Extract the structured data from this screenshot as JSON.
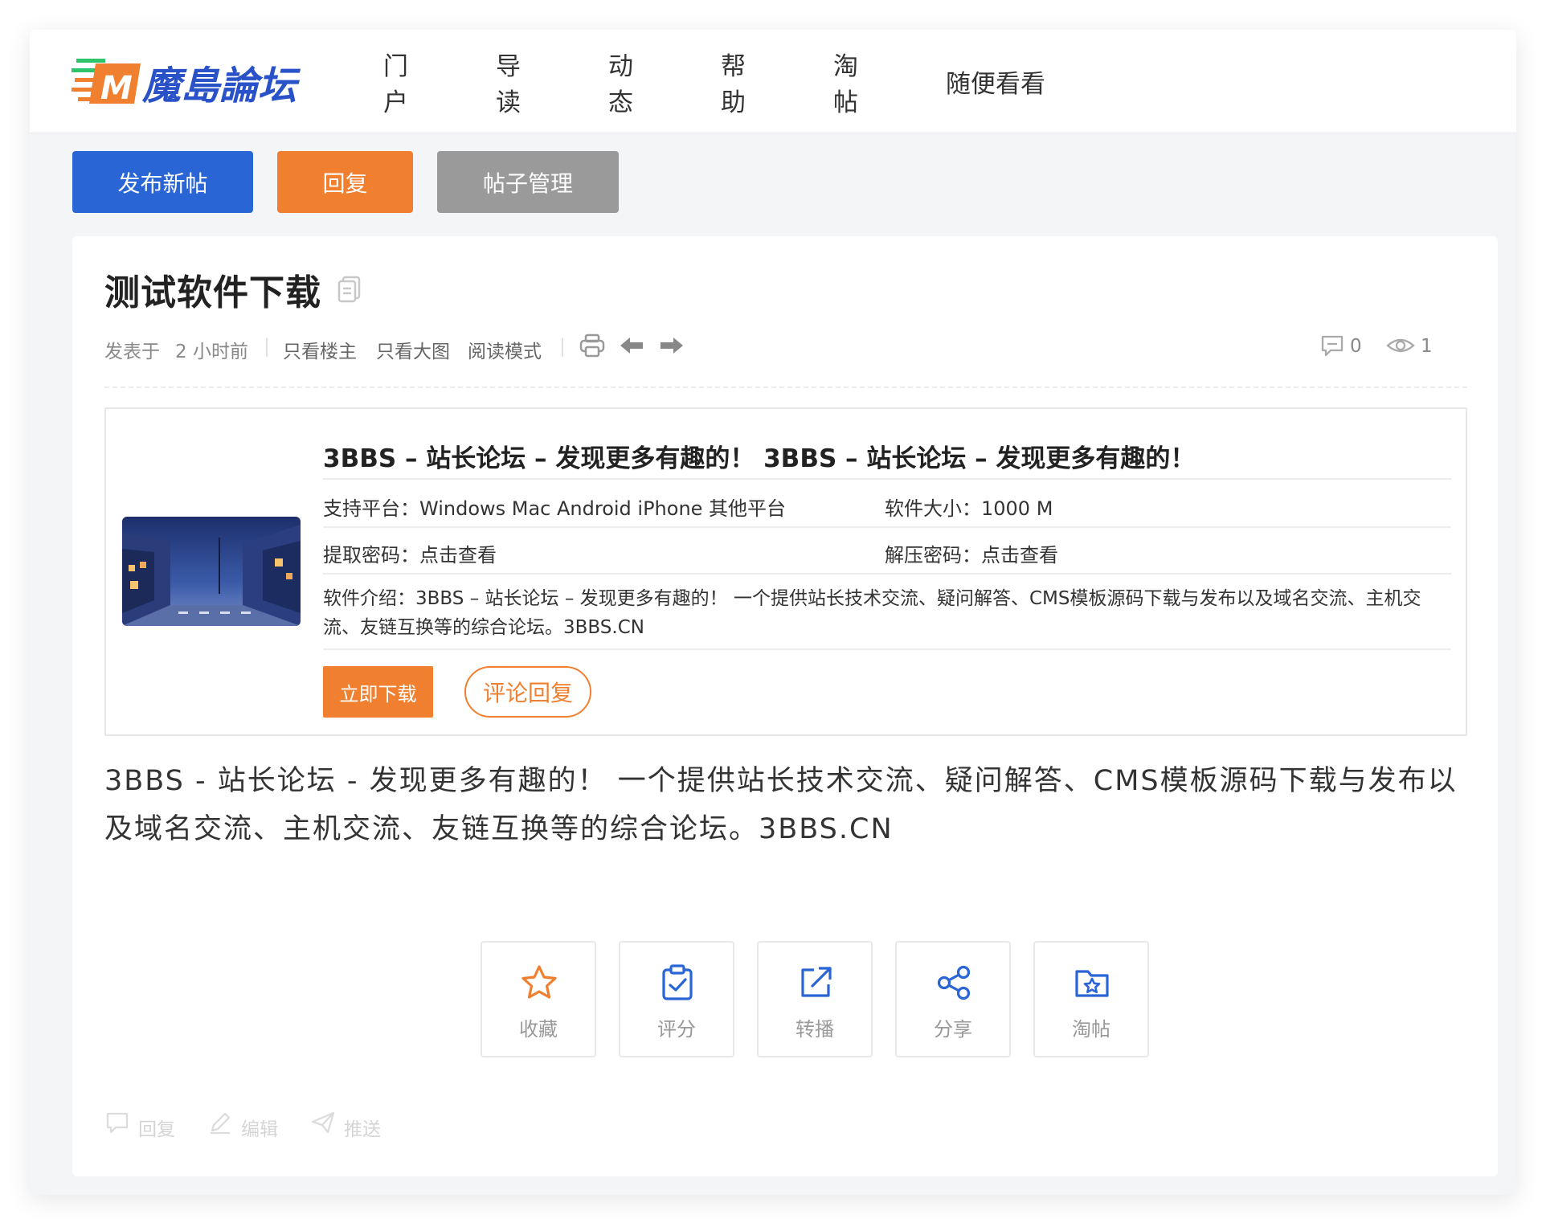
{
  "brand": {
    "logo_text": "魔島論坛",
    "logo_mark": "M",
    "colors": {
      "blue": "#2a65d6",
      "orange": "#f07f2f",
      "gray": "#9a9a9a"
    }
  },
  "nav": {
    "items": [
      "门户",
      "导读",
      "动态",
      "帮助",
      "淘帖",
      "随便看看"
    ]
  },
  "actions": {
    "new_post": "发布新帖",
    "reply": "回复",
    "manage": "帖子管理"
  },
  "thread": {
    "title": "测试软件下载",
    "posted_label": "发表于",
    "posted_time": "2 小时前",
    "only_author": "只看楼主",
    "only_images": "只看大图",
    "read_mode": "阅读模式",
    "comment_count": "0",
    "view_count": "1"
  },
  "software": {
    "title": "3BBS – 站长论坛 – 发现更多有趣的！ 3BBS – 站长论坛 – 发现更多有趣的！",
    "platform_label": "支持平台：",
    "platform_value": "Windows Mac Android iPhone 其他平台",
    "size_label": "软件大小：",
    "size_value": "1000 M",
    "extract_label": "提取密码：",
    "extract_value": "点击查看",
    "unzip_label": "解压密码：",
    "unzip_value": "点击查看",
    "intro_label": "软件介绍：",
    "intro_value": "3BBS – 站长论坛 – 发现更多有趣的！ 一个提供站长技术交流、疑问解答、CMS模板源码下载与发布以及域名交流、主机交流、友链互换等的综合论坛。3BBS.CN",
    "download_btn": "立即下载",
    "comment_btn": "评论回复"
  },
  "body_text": "3BBS - 站长论坛 - 发现更多有趣的！ 一个提供站长技术交流、疑问解答、CMS模板源码下载与发布以及域名交流、主机交流、友链互换等的综合论坛。3BBS.CN",
  "tiles": [
    {
      "label": "收藏",
      "icon": "star-icon"
    },
    {
      "label": "评分",
      "icon": "clipboard-check-icon"
    },
    {
      "label": "转播",
      "icon": "external-link-icon"
    },
    {
      "label": "分享",
      "icon": "share-icon"
    },
    {
      "label": "淘帖",
      "icon": "folder-star-icon"
    }
  ],
  "footer": {
    "reply": "回复",
    "edit": "编辑",
    "push": "推送"
  }
}
